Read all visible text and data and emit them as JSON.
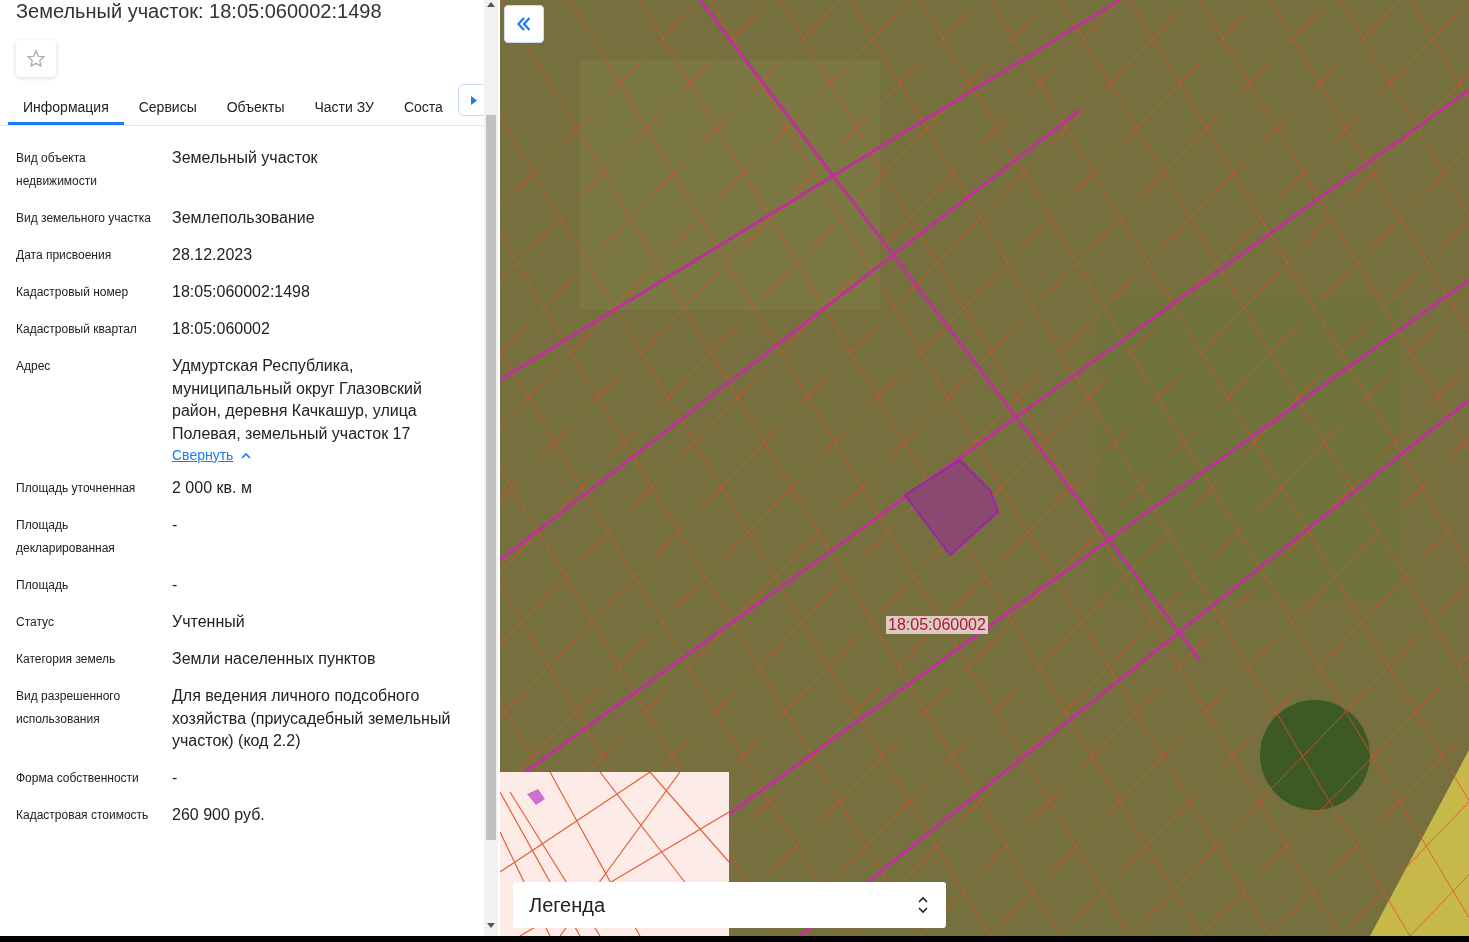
{
  "panel": {
    "title": "Земельный участок: 18:05:060002:1498",
    "favorite": false,
    "tabs": [
      {
        "label": "Информация",
        "selected": true
      },
      {
        "label": "Сервисы",
        "selected": false
      },
      {
        "label": "Объекты",
        "selected": false
      },
      {
        "label": "Части ЗУ",
        "selected": false
      },
      {
        "label": "Соста",
        "selected": false
      }
    ],
    "fields": [
      {
        "label": "Вид объекта недвижимости",
        "value": "Земельный участок"
      },
      {
        "label": "Вид земельного участка",
        "value": "Землепользование"
      },
      {
        "label": "Дата присвоения",
        "value": "28.12.2023"
      },
      {
        "label": "Кадастровый номер",
        "value": "18:05:060002:1498"
      },
      {
        "label": "Кадастровый квартал",
        "value": "18:05:060002"
      },
      {
        "label": "Адрес",
        "value": "Удмуртская Республика, муниципальный округ Глазовский район, деревня Качкашур, улица Полевая, земельный участок 17",
        "link": "Свернуть"
      },
      {
        "label": "Площадь уточненная",
        "value": "2 000 кв. м"
      },
      {
        "label": "Площадь декларированная",
        "value": "-"
      },
      {
        "label": "Площадь",
        "value": "-"
      },
      {
        "label": "Статус",
        "value": "Учтенный"
      },
      {
        "label": "Категория земель",
        "value": "Земли населенных пунктов"
      },
      {
        "label": "Вид разрешенного использования",
        "value": "Для ведения личного подсобного хозяйства (приусадебный земельный участок) (код 2.2)"
      },
      {
        "label": "Форма собственности",
        "value": "-"
      },
      {
        "label": "Кадастровая стоимость",
        "value": "260 900 руб."
      }
    ]
  },
  "map": {
    "quarter_label": "18:05:060002",
    "legend": {
      "title": "Легенда"
    }
  }
}
